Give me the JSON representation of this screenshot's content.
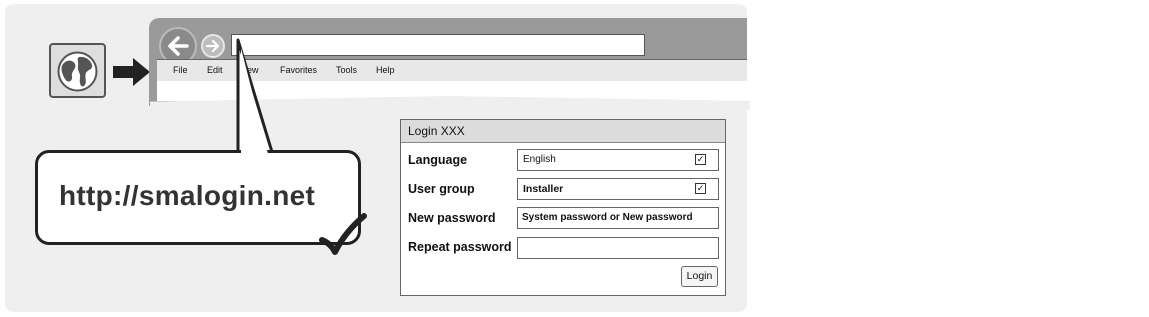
{
  "browser": {
    "menu": [
      "File",
      "Edit",
      "View",
      "Favorites",
      "Tools",
      "Help"
    ],
    "menu_visible": [
      "File",
      "Edit",
      "iew",
      "Favorites",
      "Tools",
      "Help"
    ]
  },
  "callout": {
    "url": "http://smalogin.net"
  },
  "login": {
    "title": "Login XXX",
    "rows": [
      {
        "label": "Language",
        "value": "English"
      },
      {
        "label": "User group",
        "value": "Installer"
      },
      {
        "label": "New password",
        "value": "System password or New password"
      },
      {
        "label": "Repeat password",
        "value": ""
      }
    ],
    "button": "Login"
  },
  "colors": {
    "panel": "#efefef",
    "frame": "#9a9a9a",
    "outline": "#222222"
  }
}
